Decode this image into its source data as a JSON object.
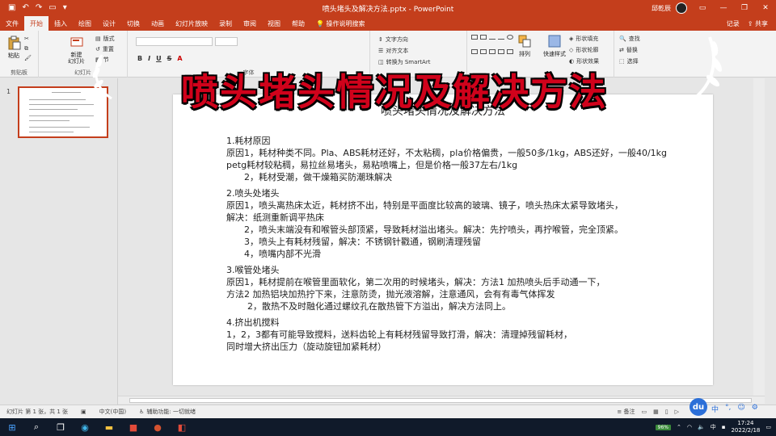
{
  "window": {
    "title": "喷头堵头及解决方法.pptx - PowerPoint",
    "user": "邱乾辰"
  },
  "menu": {
    "tabs": [
      "文件",
      "开始",
      "插入",
      "绘图",
      "设计",
      "切换",
      "动画",
      "幻灯片放映",
      "录制",
      "审阅",
      "视图",
      "帮助"
    ],
    "search_hint": "操作说明搜索",
    "record": "记录",
    "share": "共享"
  },
  "ribbon": {
    "paste": "粘贴",
    "new_slide": "新建\n幻灯片",
    "layout": "版式",
    "reset": "重置",
    "section": "节",
    "text_direction": "文字方向",
    "align_text": "对齐文本",
    "smartart": "转换为 SmartArt",
    "arrange": "排列",
    "quick_styles": "快速样式",
    "shape_fill": "形状填充",
    "shape_outline": "形状轮廓",
    "shape_effects": "形状效果",
    "find": "查找",
    "replace": "替换",
    "select": "选择",
    "group_clipboard": "剪贴板",
    "group_slides": "幻灯片",
    "group_font": "字体"
  },
  "banner": "喷头堵头情况及解决方法",
  "thumbnail": {
    "number": "1"
  },
  "slide": {
    "title": "喷头堵头情况及解决方法",
    "sections": [
      {
        "heading": "1.耗材原因",
        "lines": [
          {
            "text": "原因1，耗材种类不同。Pla、ABS耗材还好，不太粘稠，pla价格偏贵，一般50多/1kg，ABS还好，一般40/1kg",
            "indent": 0
          },
          {
            "text": "petg耗材较粘稠，易拉丝易堵头，易粘喷嘴上，但是价格一般37左右/1kg",
            "indent": 0
          },
          {
            "text": "2，耗材受潮，做干燥箱买防潮珠解决",
            "indent": 1
          }
        ]
      },
      {
        "heading": "2.喷头处堵头",
        "lines": [
          {
            "text": "原因1，喷头离热床太近，耗材挤不出，特别是平面度比较高的玻璃、镜子，喷头热床太紧导致堵头，",
            "indent": 0
          },
          {
            "text": "解决：纸测重新调平热床",
            "indent": 0
          },
          {
            "text": "2，喷头末端没有和喉管头部顶紧，导致耗材溢出堵头。解决：先拧喷头，再拧喉管，完全顶紧。",
            "indent": 1
          },
          {
            "text": "3，喷头上有耗材残留，解决：不锈钢针戳通，钢刷清理残留",
            "indent": 1
          },
          {
            "text": "4，喷嘴内部不光滑",
            "indent": 1
          }
        ]
      },
      {
        "heading": "3.喉管处堵头",
        "lines": [
          {
            "text": "原因1，耗材提前在喉管里面软化，第二次用的时候堵头，解决：方法1 加热喷头后手动通一下，",
            "indent": 0
          },
          {
            "text": "方法2 加热铝块加热拧下来，注意防烫，抛光液溶解，注意通风，会有有毒气体挥发",
            "indent": 0
          },
          {
            "text": "2，散热不及时融化通过螺纹孔在散热管下方溢出，解决方法同上。",
            "indent": 2
          }
        ]
      },
      {
        "heading": "4.挤出机搅料",
        "lines": [
          {
            "text": "1，2，3都有可能导致搅料，送料齿轮上有耗材残留导致打滑，解决：清理掉残留耗材，",
            "indent": 0
          },
          {
            "text": "同时增大挤出压力（旋动旋钮加紧耗材）",
            "indent": 0
          }
        ]
      }
    ]
  },
  "status": {
    "slide_info": "幻灯片 第 1 张，共 1 张",
    "language": "中文(中国)",
    "accessibility": "辅助功能: 一切就绪",
    "notes": "备注"
  },
  "du_badge": "du",
  "ime_items": [
    "中",
    "°,",
    "☺"
  ],
  "taskbar": {
    "battery": "96%",
    "ime": "中",
    "time": "17:24",
    "date": "2022/2/18"
  },
  "colors": {
    "accent": "#c43e1c",
    "banner_text": "#d0021b"
  }
}
